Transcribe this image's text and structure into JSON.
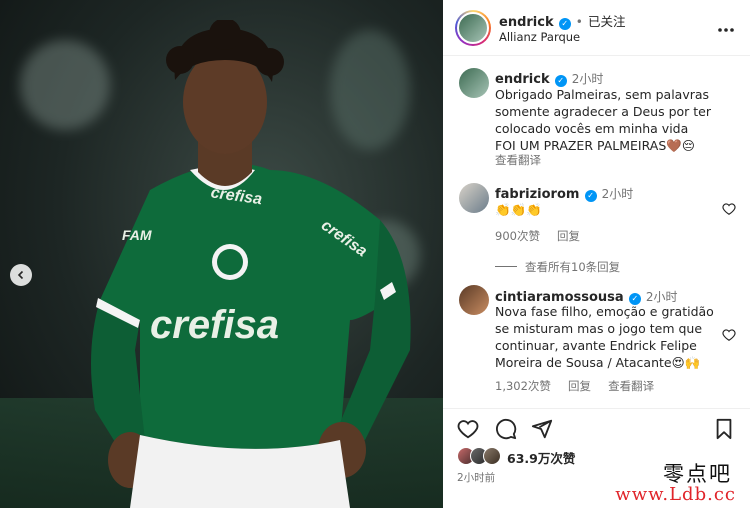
{
  "header": {
    "username": "endrick",
    "separator": "•",
    "follow_label": "已关注",
    "location": "Allianz Parque",
    "more_icon": "more-horizontal-icon"
  },
  "caption": {
    "username": "endrick",
    "time": "2小时",
    "lines": [
      "Obrigado Palmeiras, sem palavras",
      "somente agradecer a Deus por ter",
      "colocado vocês em minha vida",
      "FOI UM PRAZER PALMEIRAS🤎😔"
    ],
    "see_translation": "查看翻译"
  },
  "comments": [
    {
      "username": "fabriziorom",
      "time": "2小时",
      "text": "👏👏👏",
      "likes": "900次赞",
      "reply": "回复"
    },
    {
      "username": "cintiaramossousa",
      "time": "2小时",
      "lines": [
        "Nova fase filho, emoção e gratidão",
        "se misturam mas o jogo tem que",
        "continuar, avante Endrick Felipe",
        "Moreira de Sousa / Atacante😍🙌"
      ],
      "likes": "1,302次赞",
      "reply": "回复",
      "see_translation": "查看翻译"
    }
  ],
  "view_replies": "查看所有10条回复",
  "actions": {
    "like_icon": "heart-icon",
    "comment_icon": "comment-icon",
    "share_icon": "send-icon",
    "save_icon": "bookmark-icon",
    "likes_total": "63.9万次赞",
    "posted_time": "2小时前"
  },
  "photo": {
    "jersey_sponsor": "crefisa",
    "jersey_sleeve_sponsor": "crefisa",
    "jersey_chest_small": "FAM"
  },
  "watermark": {
    "cn": "零点吧",
    "url": "www.Ldb.cc"
  },
  "colors": {
    "accent": "#0095f6",
    "jersey_green": "#0e6b3b",
    "watermark_red": "#e0242a"
  }
}
